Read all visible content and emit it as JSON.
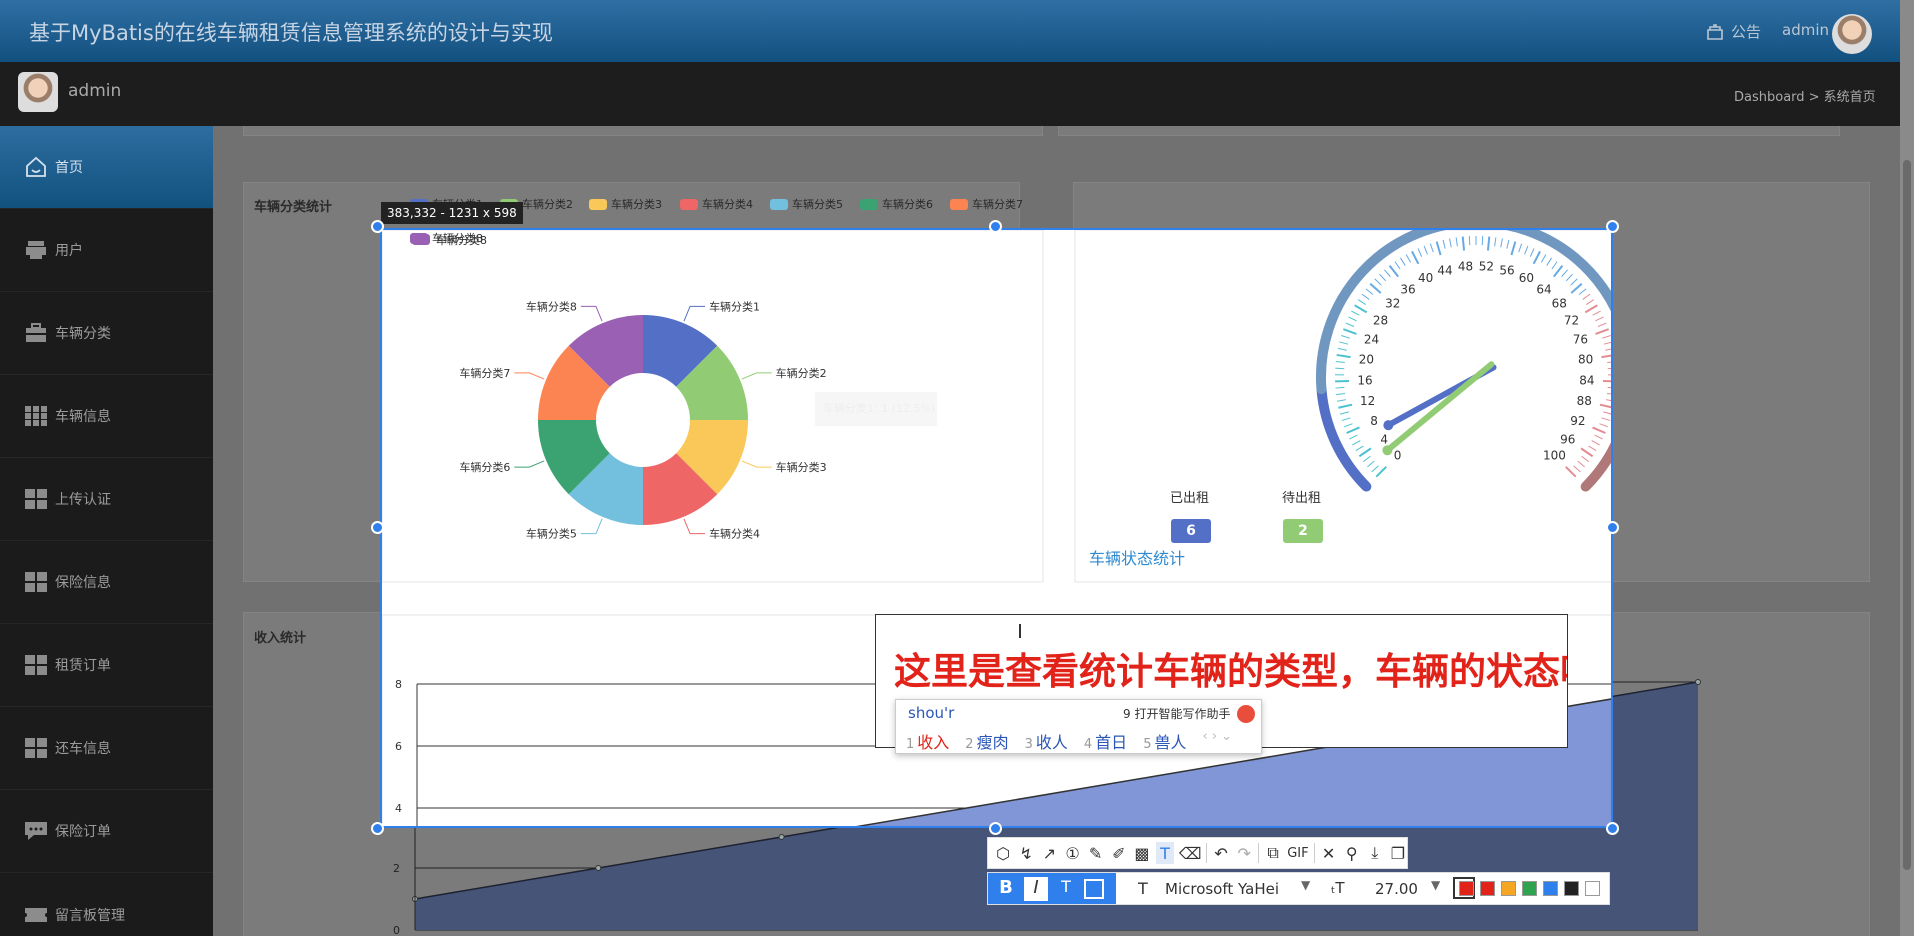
{
  "app": {
    "title": "基于MyBatis的在线车辆租赁信息管理系统的设计与实现"
  },
  "header": {
    "notice_label": "公告",
    "user": "admin"
  },
  "subheader": {
    "user": "admin",
    "breadcrumb": "Dashboard > 系统首页"
  },
  "sidebar": {
    "items": [
      {
        "label": "首页",
        "icon": "home-icon",
        "active": true
      },
      {
        "label": "用户",
        "icon": "user-icon"
      },
      {
        "label": "车辆分类",
        "icon": "briefcase-icon"
      },
      {
        "label": "车辆信息",
        "icon": "grid-icon"
      },
      {
        "label": "上传认证",
        "icon": "grid-icon"
      },
      {
        "label": "保险信息",
        "icon": "grid-icon"
      },
      {
        "label": "租赁订单",
        "icon": "grid-icon"
      },
      {
        "label": "还车信息",
        "icon": "grid-icon"
      },
      {
        "label": "保险订单",
        "icon": "chat-icon"
      },
      {
        "label": "留言板管理",
        "icon": "ticket-icon"
      }
    ]
  },
  "pie_card": {
    "title": "车辆分类统计",
    "tooltip": "车辆分类1: 1 (12.5%)"
  },
  "gauge_card": {
    "title": "车辆状态统计",
    "rented_label": "已出租",
    "rented_value": "6",
    "available_label": "待出租",
    "available_value": "2"
  },
  "income_card": {
    "title": "收入统计"
  },
  "screenshot_tool": {
    "size_tip": "383,332 - 1231 x 598",
    "annotation_text": "这里是查看统计车辆的类型，车辆的状态吧",
    "font_name": "Microsoft YaHei",
    "font_size": "27.00",
    "gif_label": "GIF",
    "colors": [
      "#e2231a",
      "#e2231a",
      "#f5a623",
      "#2ea44f",
      "#2f80ed",
      "#222222",
      "#ffffff"
    ]
  },
  "ime": {
    "input": "shou'r",
    "assistant": "9 打开智能写作助手",
    "candidates": [
      {
        "num": "1",
        "text": "收入"
      },
      {
        "num": "2",
        "text": "瘦肉"
      },
      {
        "num": "3",
        "text": "收人"
      },
      {
        "num": "4",
        "text": "首日"
      },
      {
        "num": "5",
        "text": "兽人"
      }
    ]
  },
  "chart_data": [
    {
      "type": "pie",
      "title": "车辆分类统计",
      "categories": [
        "车辆分类1",
        "车辆分类2",
        "车辆分类3",
        "车辆分类4",
        "车辆分类5",
        "车辆分类6",
        "车辆分类7",
        "车辆分类8"
      ],
      "values": [
        1,
        1,
        1,
        1,
        1,
        1,
        1,
        1
      ],
      "colors": [
        "#5470c6",
        "#91cc75",
        "#fac858",
        "#ee6666",
        "#73c0de",
        "#3ba272",
        "#fc8452",
        "#9a60b4"
      ],
      "legend": "top"
    },
    {
      "type": "gauge",
      "title": "车辆状态统计",
      "range": [
        0,
        100
      ],
      "ticks": [
        0,
        4,
        8,
        12,
        16,
        20,
        24,
        28,
        32,
        36,
        40,
        44,
        48,
        52,
        56,
        60,
        64,
        68,
        72,
        76,
        80,
        84,
        88,
        92,
        96,
        100
      ],
      "series": [
        {
          "name": "已出租",
          "value": 6
        },
        {
          "name": "待出租",
          "value": 2
        }
      ]
    },
    {
      "type": "area",
      "title": "收入统计",
      "ylim": [
        0,
        8
      ],
      "yticks": [
        0,
        2,
        4,
        6,
        8
      ],
      "values": [
        1,
        2,
        3,
        4,
        5,
        6,
        7,
        8
      ]
    }
  ]
}
